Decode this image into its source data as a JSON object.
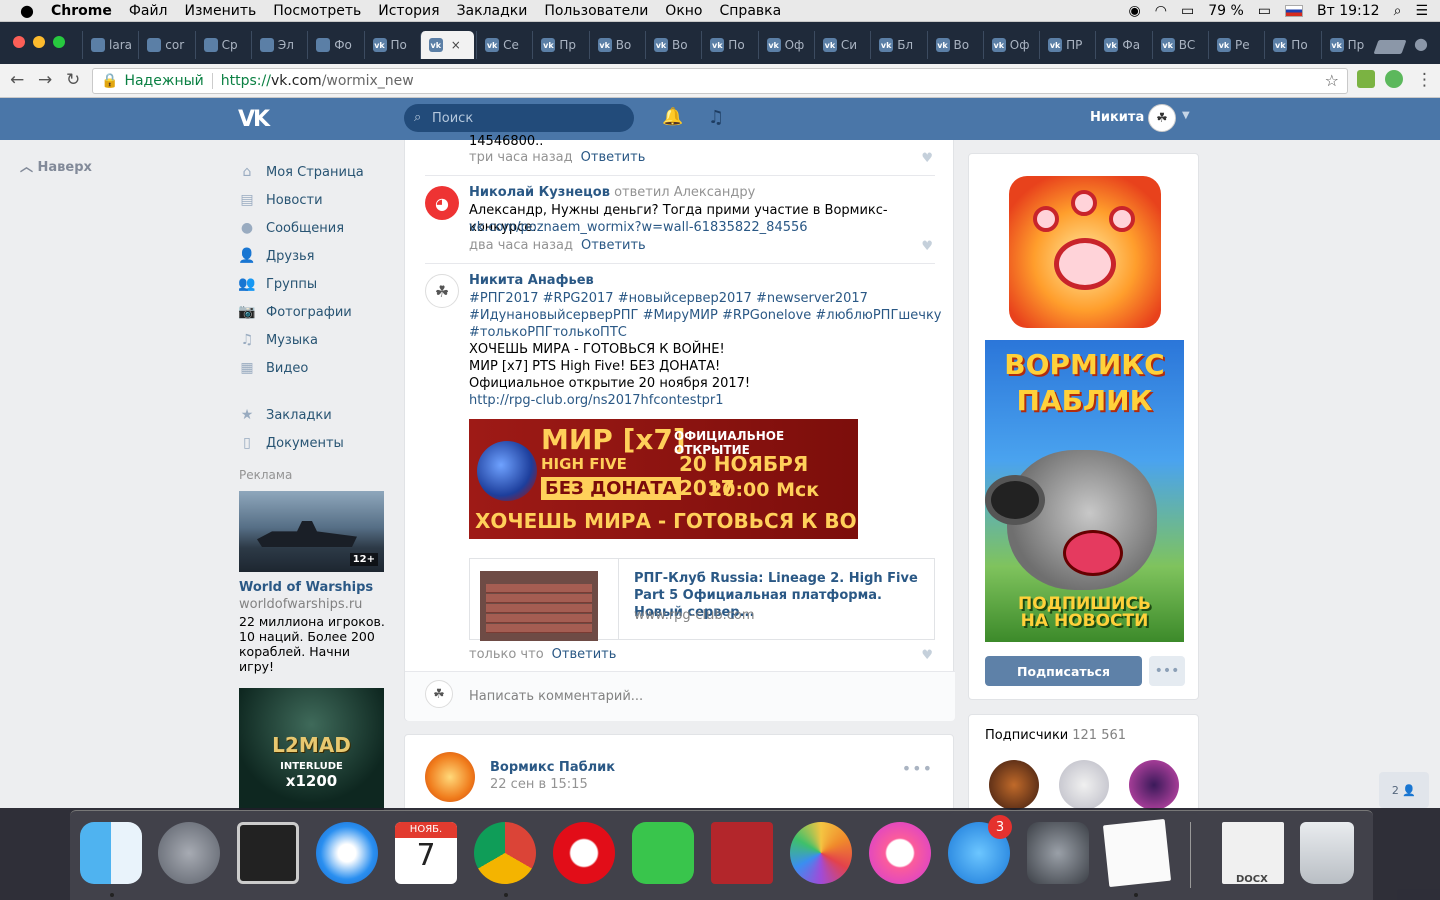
{
  "menubar": {
    "apple": "",
    "app": "Chrome",
    "items": [
      "Файл",
      "Изменить",
      "Посмотреть",
      "История",
      "Закладки",
      "Пользователи",
      "Окно",
      "Справка"
    ],
    "battery": "79 %",
    "time": "Вт 19:12"
  },
  "tabs": [
    {
      "label": "lara",
      "fav": "github-icon"
    },
    {
      "label": "cor",
      "fav": "t-icon"
    },
    {
      "label": "Ср",
      "fav": "blue-icon"
    },
    {
      "label": "Эл",
      "fav": "doc-icon"
    },
    {
      "label": "Фо",
      "fav": "game-icon"
    },
    {
      "label": "По",
      "fav": "vk-icon"
    },
    {
      "label": "",
      "fav": "vk-icon",
      "active": true
    },
    {
      "label": "Се",
      "fav": "vk-icon"
    },
    {
      "label": "Пр",
      "fav": "vk-icon"
    },
    {
      "label": "Во",
      "fav": "vk-icon"
    },
    {
      "label": "Во",
      "fav": "vk-icon"
    },
    {
      "label": "По",
      "fav": "vk-icon"
    },
    {
      "label": "Оф",
      "fav": "vk-icon"
    },
    {
      "label": "Си",
      "fav": "vk-icon"
    },
    {
      "label": "Бл",
      "fav": "vk-icon"
    },
    {
      "label": "Во",
      "fav": "vk-icon"
    },
    {
      "label": "Оф",
      "fav": "vk-icon"
    },
    {
      "label": "ПР",
      "fav": "vk-icon"
    },
    {
      "label": "Фа",
      "fav": "vk-icon"
    },
    {
      "label": "ВС",
      "fav": "vk-icon"
    },
    {
      "label": "Ре",
      "fav": "vk-icon"
    },
    {
      "label": "По",
      "fav": "vk-icon"
    },
    {
      "label": "Пр",
      "fav": "vk-icon"
    }
  ],
  "address": {
    "secure_label": "Надежный",
    "scheme": "https://",
    "host": "vk.com",
    "path": "/wormix_new"
  },
  "vk": {
    "logo": "VK",
    "search_placeholder": "Поиск",
    "username": "Никита",
    "up_label": "Наверх"
  },
  "sidenav": [
    {
      "label": "Моя Страница",
      "icon": "home-icon",
      "glyph": "⌂"
    },
    {
      "label": "Новости",
      "icon": "news-icon",
      "glyph": "▤"
    },
    {
      "label": "Сообщения",
      "icon": "messages-icon",
      "glyph": "●"
    },
    {
      "label": "Друзья",
      "icon": "friends-icon",
      "glyph": "👤"
    },
    {
      "label": "Группы",
      "icon": "groups-icon",
      "glyph": "👥"
    },
    {
      "label": "Фотографии",
      "icon": "photos-icon",
      "glyph": "📷"
    },
    {
      "label": "Музыка",
      "icon": "music-icon",
      "glyph": "♫"
    },
    {
      "label": "Видео",
      "icon": "video-icon",
      "glyph": "▦"
    }
  ],
  "sidenav2": [
    {
      "label": "Закладки",
      "icon": "bookmarks-icon",
      "glyph": "★"
    },
    {
      "label": "Документы",
      "icon": "documents-icon",
      "glyph": "▯"
    }
  ],
  "ads": {
    "label": "Реклама",
    "ad1": {
      "title": "World of Warships",
      "domain": "worldofwarships.ru",
      "desc": "22 миллиона игроков. 10 наций. Более 200 кораблей. Начни игру!",
      "age": "12+"
    },
    "ad2": {
      "title": "L2MAD",
      "sub": "INTERLUDE",
      "mult": "x1200"
    }
  },
  "comments": {
    "c0": {
      "truncated": "14546800..",
      "time": "три часа назад",
      "reply": "Ответить"
    },
    "c1": {
      "author": "Николай Кузнецов",
      "rel": "ответил Александру",
      "line1": "Александр, Нужны деньги? Тогда прими участие в Вормикс-конкурсе:",
      "link": "vk.com/poznaem_wormix?w=wall-61835822_84556",
      "time": "два часа назад",
      "reply": "Ответить"
    },
    "c2": {
      "author": "Никита Анафьев",
      "hash1": "#РПГ2017 #RPG2017 #новыйсервер2017 #newserver2017",
      "hash2": "#ИдунановыйсерверРПГ #МируМИР #RPGonelove #люблюРПГшечку",
      "hash3": "#толькоРПГтолькоПТС",
      "t1": "ХОЧЕШЬ МИРА - ГОТОВЬСЯ К ВОЙНЕ!",
      "t2": "МИР [x7] PTS High Five! БЕЗ ДОНАТА!",
      "t3": "Официальное открытие 20 ноября 2017!",
      "link": "http://rpg-club.org/ns2017hfcontestpr1",
      "banner": {
        "mir": "МИР [x7]",
        "hf": "HIGH FIVE",
        "nd": "БЕЗ ДОНАТА",
        "oo": "ОФИЦИАЛЬНОЕ ОТКРЫТИЕ",
        "dt": "20 НОЯБРЯ 2017",
        "tm": "20:00 Мск",
        "war": "ХОЧЕШЬ МИРА - ГОТОВЬСЯ К ВОЙНЕ"
      },
      "card": {
        "title": "РПГ-Клуб Russia: Lineage 2. High Five Part 5 Официальная платформа. Новый сервер...",
        "domain": "www.rpg-club.com"
      },
      "time": "только что",
      "reply": "Ответить"
    },
    "composer_placeholder": "Написать комментарий..."
  },
  "post2": {
    "name": "Вормикс Паблик",
    "date": "22 сен в 15:15"
  },
  "group": {
    "poster_t1": "ВОРМИКС",
    "poster_t2": "ПАБЛИК",
    "poster_cta1": "ПОДПИШИСЬ",
    "poster_cta2": "НА НОВОСТИ",
    "subscribe": "Подписаться",
    "followers_label": "Подписчики",
    "followers_count": "121 561"
  },
  "chat_badge": "2",
  "dock": {
    "calendar_month": "НОЯБ.",
    "calendar_day": "7",
    "appstore_badge": "3",
    "docx_label": "DOCX"
  }
}
